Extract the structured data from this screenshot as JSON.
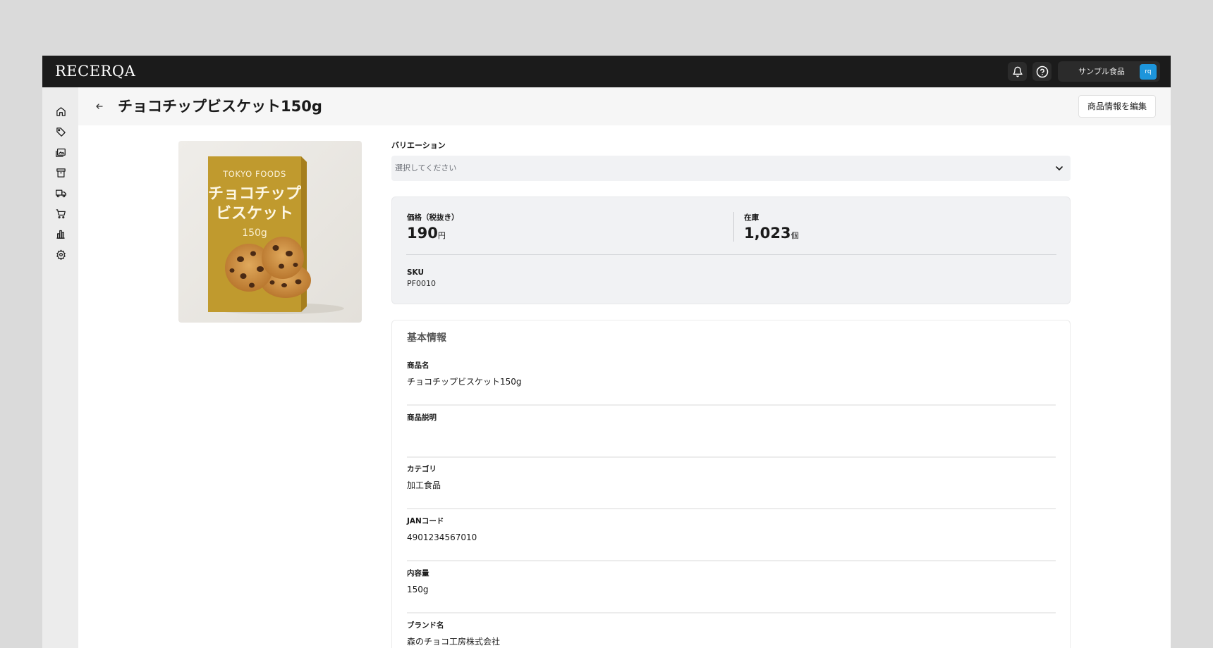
{
  "topbar": {
    "logo": "RECERQA",
    "org_name": "サンプル食品",
    "avatar_initials": "rq",
    "icons": [
      "bell-icon",
      "help-icon"
    ]
  },
  "sidebar": {
    "items": [
      {
        "icon": "home-icon"
      },
      {
        "icon": "tag-icon"
      },
      {
        "icon": "images-icon"
      },
      {
        "icon": "archive-box-icon"
      },
      {
        "icon": "truck-icon"
      },
      {
        "icon": "cart-icon"
      },
      {
        "icon": "bar-chart-icon"
      },
      {
        "icon": "gear-icon"
      }
    ]
  },
  "header": {
    "title": "チョコチップビスケット150g",
    "edit_button": "商品情報を編集"
  },
  "product_image": {
    "brand": "TOKYO FOODS",
    "name_line1": "チョコチップ",
    "name_line2": "ビスケット",
    "weight": "150g"
  },
  "variation": {
    "label": "バリエーション",
    "placeholder": "選択してください"
  },
  "stats": {
    "price_label": "価格（税抜き）",
    "price_value": "190",
    "price_unit": "円",
    "stock_label": "在庫",
    "stock_value": "1,023",
    "stock_unit": "個",
    "sku_label": "SKU",
    "sku_value": "PF0010"
  },
  "basic_info": {
    "title": "基本情報",
    "fields": [
      {
        "label": "商品名",
        "value": "チョコチップビスケット150g"
      },
      {
        "label": "商品説明",
        "value": ""
      },
      {
        "label": "カテゴリ",
        "value": "加工食品"
      },
      {
        "label": "JANコード",
        "value": "4901234567010"
      },
      {
        "label": "内容量",
        "value": "150g"
      },
      {
        "label": "ブランド名",
        "value": "森のチョコ工房株式会社"
      }
    ]
  },
  "colors": {
    "topbar_bg": "#1b1b1b",
    "avatar_accent": "#1d95db",
    "box_mustard": "#c09a2e"
  }
}
